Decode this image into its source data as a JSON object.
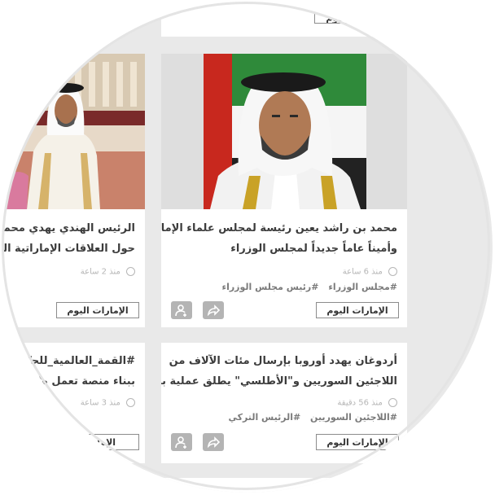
{
  "source_label": "الإمارات اليوم",
  "top_card": {
    "source": "الإمارات اليوم"
  },
  "cards": [
    {
      "title_lines": [
        "محمد بن راشد يعين رئيسة لمجلس علماء الإمارات",
        "وأميناً عاماً جديداً لمجلس الوزراء"
      ],
      "time": "منذ 6 ساعة",
      "tags": [
        "#مجلس الوزراء",
        "#رئيس مجلس الوزراء"
      ],
      "source": "الإمارات اليوم"
    },
    {
      "title_lines": [
        "الرئيس الهندي يهدي محمد بن",
        "حول العلاقات الإماراتية الهندية"
      ],
      "time": "منذ 2 ساعة",
      "source": "الإمارات اليوم"
    },
    {
      "title_lines": [
        "أردوغان يهدد أوروبا بإرسال مئات الآلاف من",
        "اللاجئين السوريين و\"الأطلسي\" يطلق عملية بحرية"
      ],
      "time": "منذ 56 دقيقة",
      "tags": [
        "#اللاجئين السوريين",
        "#الرئيس التركي"
      ],
      "source": "الإمارات اليوم"
    },
    {
      "title_lines": [
        "#القمة_العالمية_للحكومات",
        "ببناء منصة تعمل طوال"
      ],
      "time": "منذ 3 ساعة",
      "source": "الإمارات"
    }
  ],
  "icons": {
    "share": "share-arrow-icon",
    "follow": "add-user-icon",
    "clock": "clock-icon"
  },
  "colors": {
    "page_bg": "#e9e9e9",
    "card_bg": "#ffffff",
    "title": "#3c3c3c",
    "meta": "#b6b6b6",
    "tag": "#7a7a7a",
    "action_button": "#b4b4b4",
    "flag_red": "#c8281e",
    "flag_green": "#2f8a3a"
  }
}
